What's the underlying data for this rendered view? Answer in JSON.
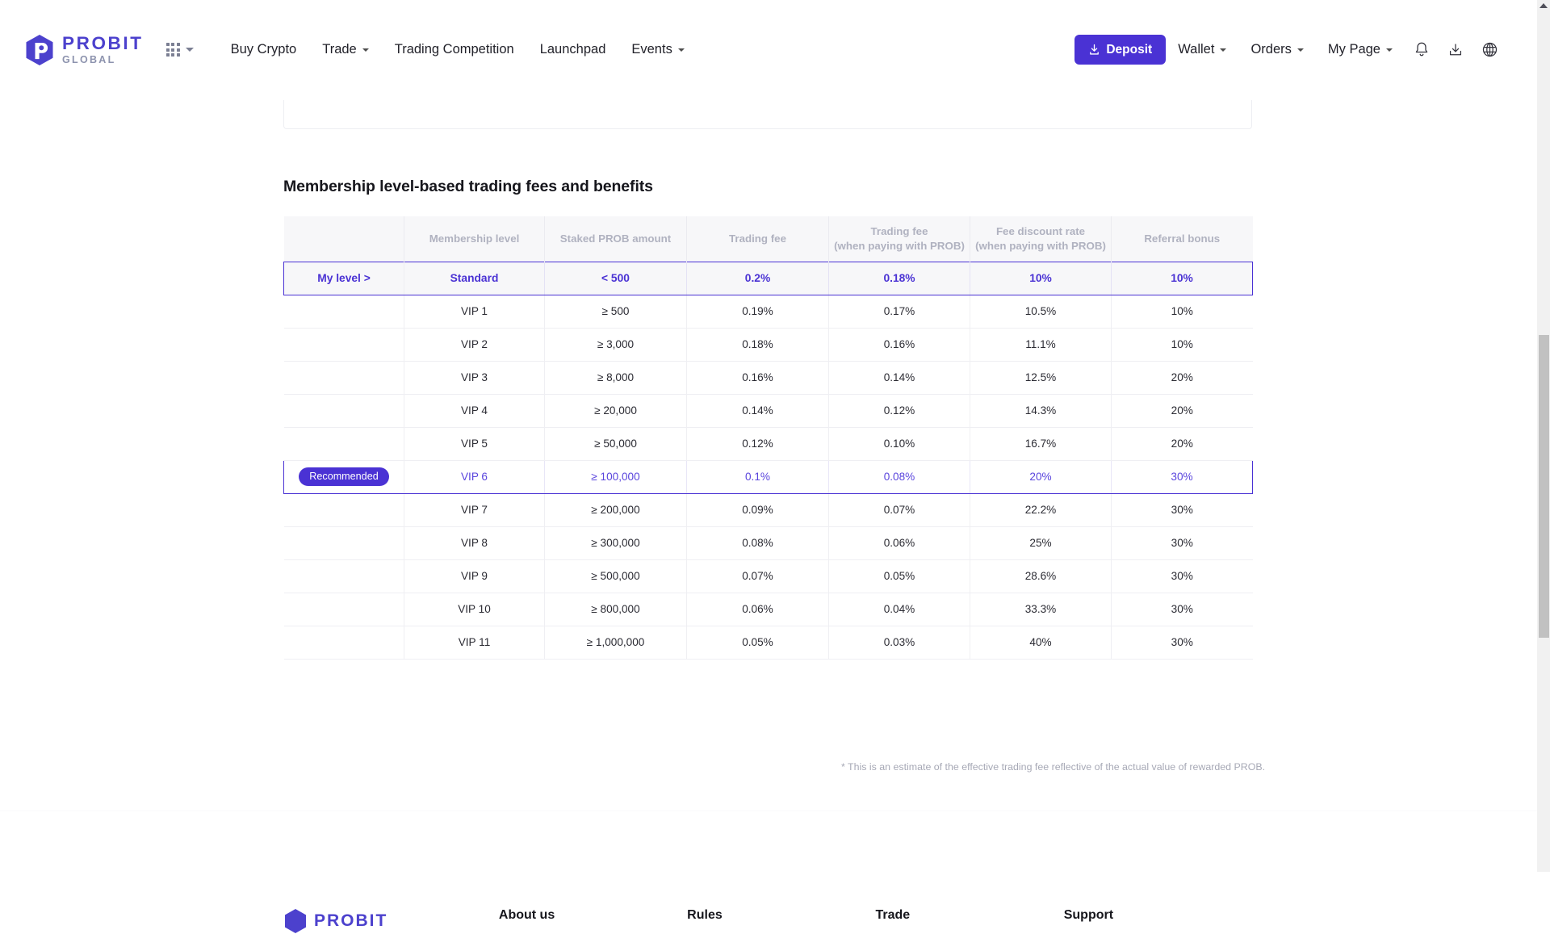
{
  "header": {
    "logo": {
      "primary": "PROBIT",
      "secondary": "GLOBAL"
    },
    "apps_icon": "grid-icon",
    "nav": [
      {
        "label": "Buy Crypto",
        "caret": false
      },
      {
        "label": "Trade",
        "caret": true
      },
      {
        "label": "Trading Competition",
        "caret": false
      },
      {
        "label": "Launchpad",
        "caret": false
      },
      {
        "label": "Events",
        "caret": true
      }
    ],
    "deposit_label": "Deposit",
    "deposit_icon": "download-icon",
    "deposit_color": "#4a32d4",
    "right_menus": [
      {
        "label": "Wallet",
        "caret": true
      },
      {
        "label": "Orders",
        "caret": true
      },
      {
        "label": "My Page",
        "caret": true
      }
    ],
    "icons": [
      {
        "name": "bell-icon"
      },
      {
        "name": "download-app-icon"
      },
      {
        "name": "globe-language-icon"
      }
    ]
  },
  "main": {
    "section_title": "Membership level-based trading fees and benefits",
    "footnote": "* This is an estimate of the effective trading fee reflective of the actual value of rewarded PROB.",
    "accent_color": "#4a32d4"
  },
  "table": {
    "columns": [
      "",
      "Membership level",
      "Staked PROB amount",
      "Trading fee",
      "Trading fee\n(when paying with PROB)",
      "Fee discount rate\n(when paying with PROB)",
      "Referral bonus"
    ],
    "columns_multiline": [
      {
        "line1": "",
        "line2": ""
      },
      {
        "line1": "Membership level",
        "line2": ""
      },
      {
        "line1": "Staked PROB amount",
        "line2": ""
      },
      {
        "line1": "Trading fee",
        "line2": ""
      },
      {
        "line1": "Trading fee",
        "line2": "(when paying with PROB)"
      },
      {
        "line1": "Fee discount rate",
        "line2": "(when paying with PROB)"
      },
      {
        "line1": "Referral bonus",
        "line2": ""
      }
    ],
    "my_level_label": "My level >",
    "recommended_label": "Recommended",
    "rows": [
      {
        "tag": "My level >",
        "tag_type": "mylevel",
        "level": "Standard",
        "staked": "< 500",
        "fee": "0.2%",
        "fee_prob": "0.18%",
        "discount": "10%",
        "referral": "10%",
        "highlight": "mylevel"
      },
      {
        "tag": "",
        "tag_type": "none",
        "level": "VIP 1",
        "staked": "≥ 500",
        "fee": "0.19%",
        "fee_prob": "0.17%",
        "discount": "10.5%",
        "referral": "10%",
        "highlight": "none"
      },
      {
        "tag": "",
        "tag_type": "none",
        "level": "VIP 2",
        "staked": "≥ 3,000",
        "fee": "0.18%",
        "fee_prob": "0.16%",
        "discount": "11.1%",
        "referral": "10%",
        "highlight": "none"
      },
      {
        "tag": "",
        "tag_type": "none",
        "level": "VIP 3",
        "staked": "≥ 8,000",
        "fee": "0.16%",
        "fee_prob": "0.14%",
        "discount": "12.5%",
        "referral": "20%",
        "highlight": "none"
      },
      {
        "tag": "",
        "tag_type": "none",
        "level": "VIP 4",
        "staked": "≥ 20,000",
        "fee": "0.14%",
        "fee_prob": "0.12%",
        "discount": "14.3%",
        "referral": "20%",
        "highlight": "none"
      },
      {
        "tag": "",
        "tag_type": "none",
        "level": "VIP 5",
        "staked": "≥ 50,000",
        "fee": "0.12%",
        "fee_prob": "0.10%",
        "discount": "16.7%",
        "referral": "20%",
        "highlight": "none"
      },
      {
        "tag": "Recommended",
        "tag_type": "badge",
        "level": "VIP 6",
        "staked": "≥ 100,000",
        "fee": "0.1%",
        "fee_prob": "0.08%",
        "discount": "20%",
        "referral": "30%",
        "highlight": "recommended"
      },
      {
        "tag": "",
        "tag_type": "none",
        "level": "VIP 7",
        "staked": "≥ 200,000",
        "fee": "0.09%",
        "fee_prob": "0.07%",
        "discount": "22.2%",
        "referral": "30%",
        "highlight": "none"
      },
      {
        "tag": "",
        "tag_type": "none",
        "level": "VIP 8",
        "staked": "≥ 300,000",
        "fee": "0.08%",
        "fee_prob": "0.06%",
        "discount": "25%",
        "referral": "30%",
        "highlight": "none"
      },
      {
        "tag": "",
        "tag_type": "none",
        "level": "VIP 9",
        "staked": "≥ 500,000",
        "fee": "0.07%",
        "fee_prob": "0.05%",
        "discount": "28.6%",
        "referral": "30%",
        "highlight": "none"
      },
      {
        "tag": "",
        "tag_type": "none",
        "level": "VIP 10",
        "staked": "≥ 800,000",
        "fee": "0.06%",
        "fee_prob": "0.04%",
        "discount": "33.3%",
        "referral": "30%",
        "highlight": "none"
      },
      {
        "tag": "",
        "tag_type": "none",
        "level": "VIP 11",
        "staked": "≥ 1,000,000",
        "fee": "0.05%",
        "fee_prob": "0.03%",
        "discount": "40%",
        "referral": "30%",
        "highlight": "none"
      }
    ]
  },
  "footer": {
    "logo": "PROBIT",
    "columns": [
      "About us",
      "Rules",
      "Trade",
      "Support"
    ]
  },
  "scrollbar": {
    "position_percent": 45
  }
}
